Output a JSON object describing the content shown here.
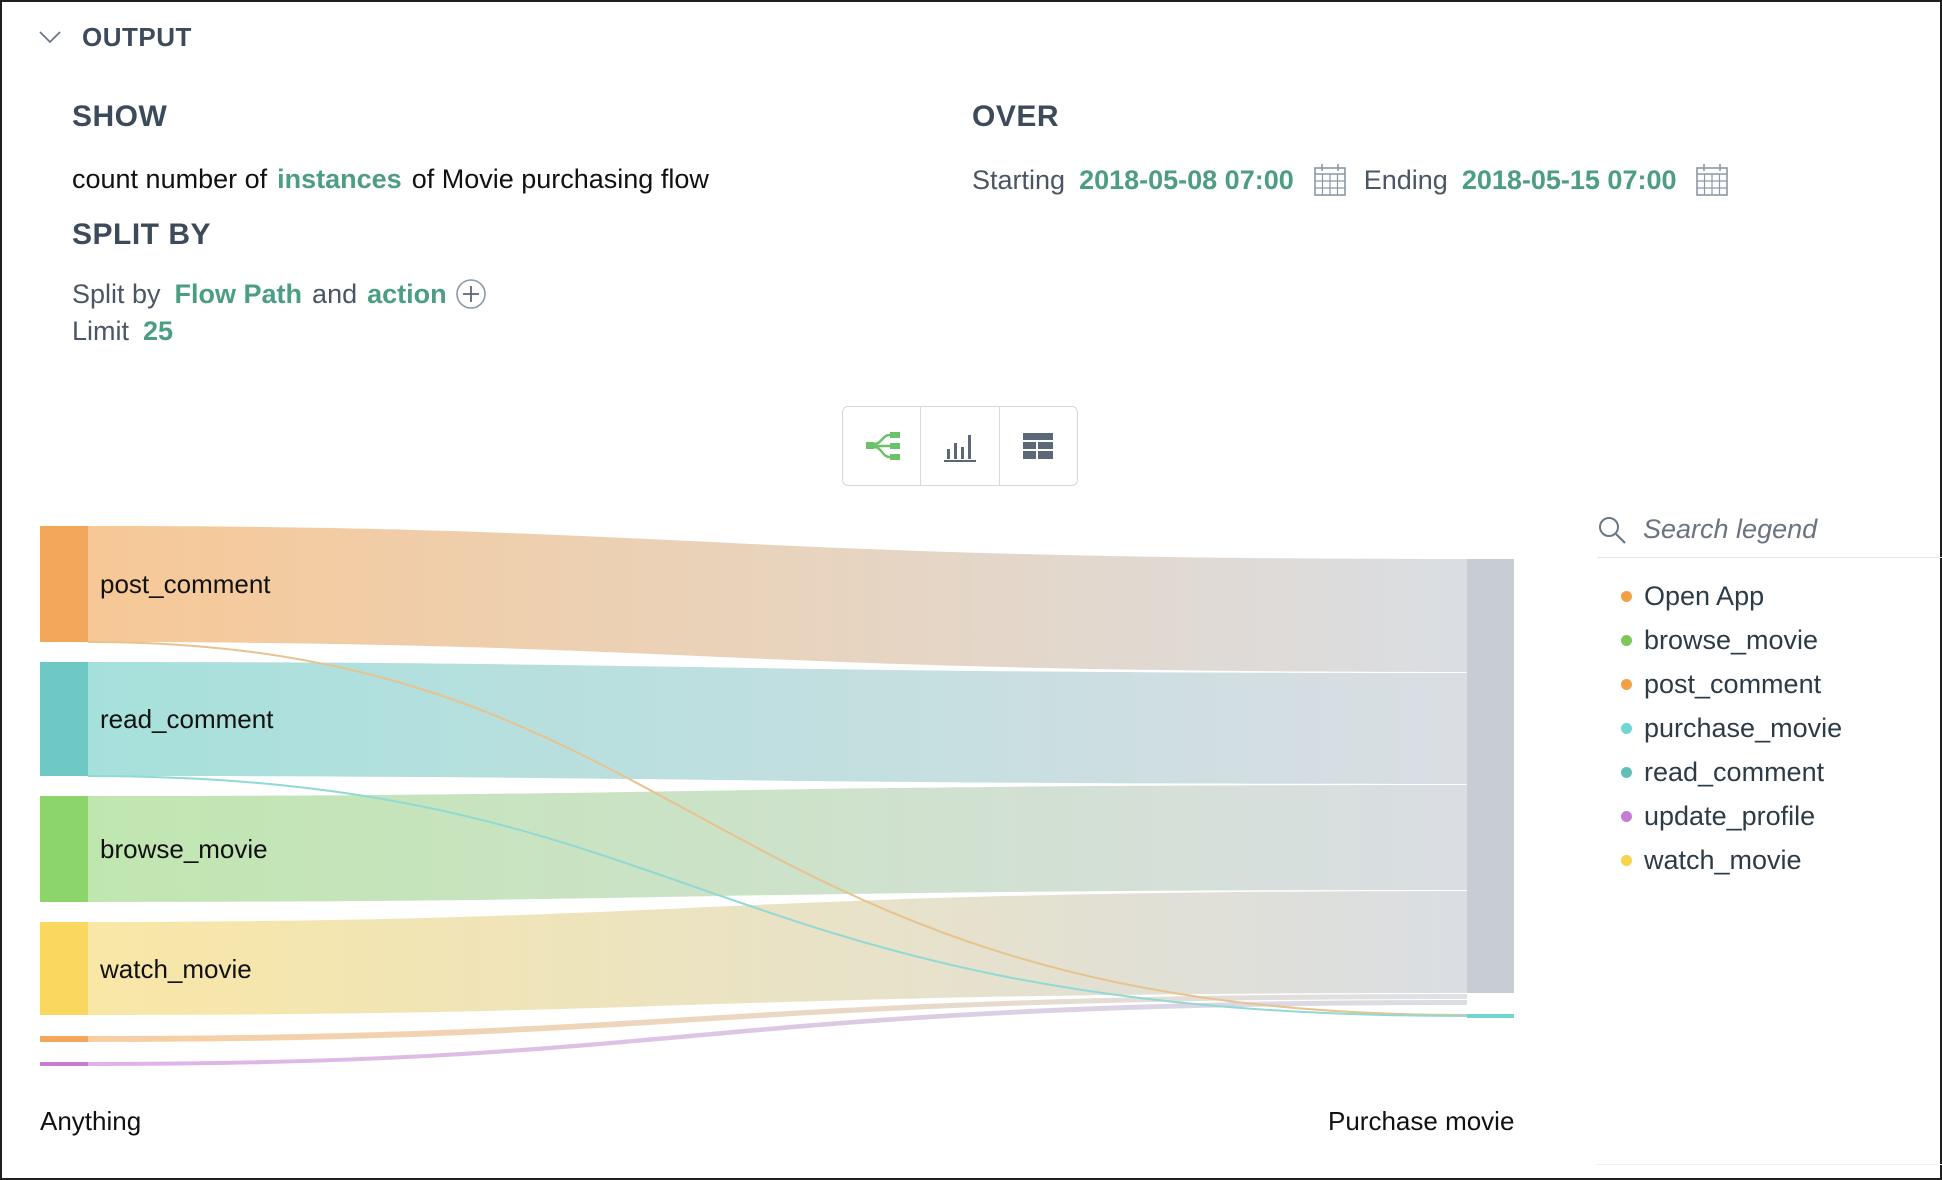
{
  "output": {
    "title": "OUTPUT"
  },
  "show": {
    "heading": "SHOW",
    "prefix": "count number of",
    "metric": "instances",
    "suffix": "of Movie purchasing flow"
  },
  "over": {
    "heading": "OVER",
    "start_label": "Starting",
    "start_value": "2018-05-08 07:00",
    "end_label": "Ending",
    "end_value": "2018-05-15 07:00"
  },
  "split": {
    "heading": "SPLIT BY",
    "label": "Split by",
    "field1": "Flow Path",
    "connector": "and",
    "field2": "action",
    "limit_label": "Limit",
    "limit_value": "25"
  },
  "view_switch": {
    "active": "sankey",
    "options": [
      "sankey-view-icon",
      "bar-chart-icon",
      "table-view-icon"
    ]
  },
  "sankey": {
    "left_axis_label": "Anything",
    "right_axis_label": "Purchase movie",
    "target_node": "Purchase movie",
    "nodes": [
      {
        "name": "post_comment",
        "color": "#f2a75a"
      },
      {
        "name": "read_comment",
        "color": "#6ec8c4"
      },
      {
        "name": "browse_movie",
        "color": "#8bd56a"
      },
      {
        "name": "watch_movie",
        "color": "#fad860"
      },
      {
        "name": "Open App",
        "color": "#f2a75a"
      },
      {
        "name": "update_profile",
        "color": "#c67cd3"
      }
    ]
  },
  "legend": {
    "search_placeholder": "Search legend",
    "items": [
      {
        "label": "Open App",
        "color": "#f2a045"
      },
      {
        "label": "browse_movie",
        "color": "#7cc857"
      },
      {
        "label": "post_comment",
        "color": "#f2a045"
      },
      {
        "label": "purchase_movie",
        "color": "#6fd6d2"
      },
      {
        "label": "read_comment",
        "color": "#5fbfb8"
      },
      {
        "label": "update_profile",
        "color": "#c67cd3"
      },
      {
        "label": "watch_movie",
        "color": "#f6d648"
      }
    ]
  }
}
